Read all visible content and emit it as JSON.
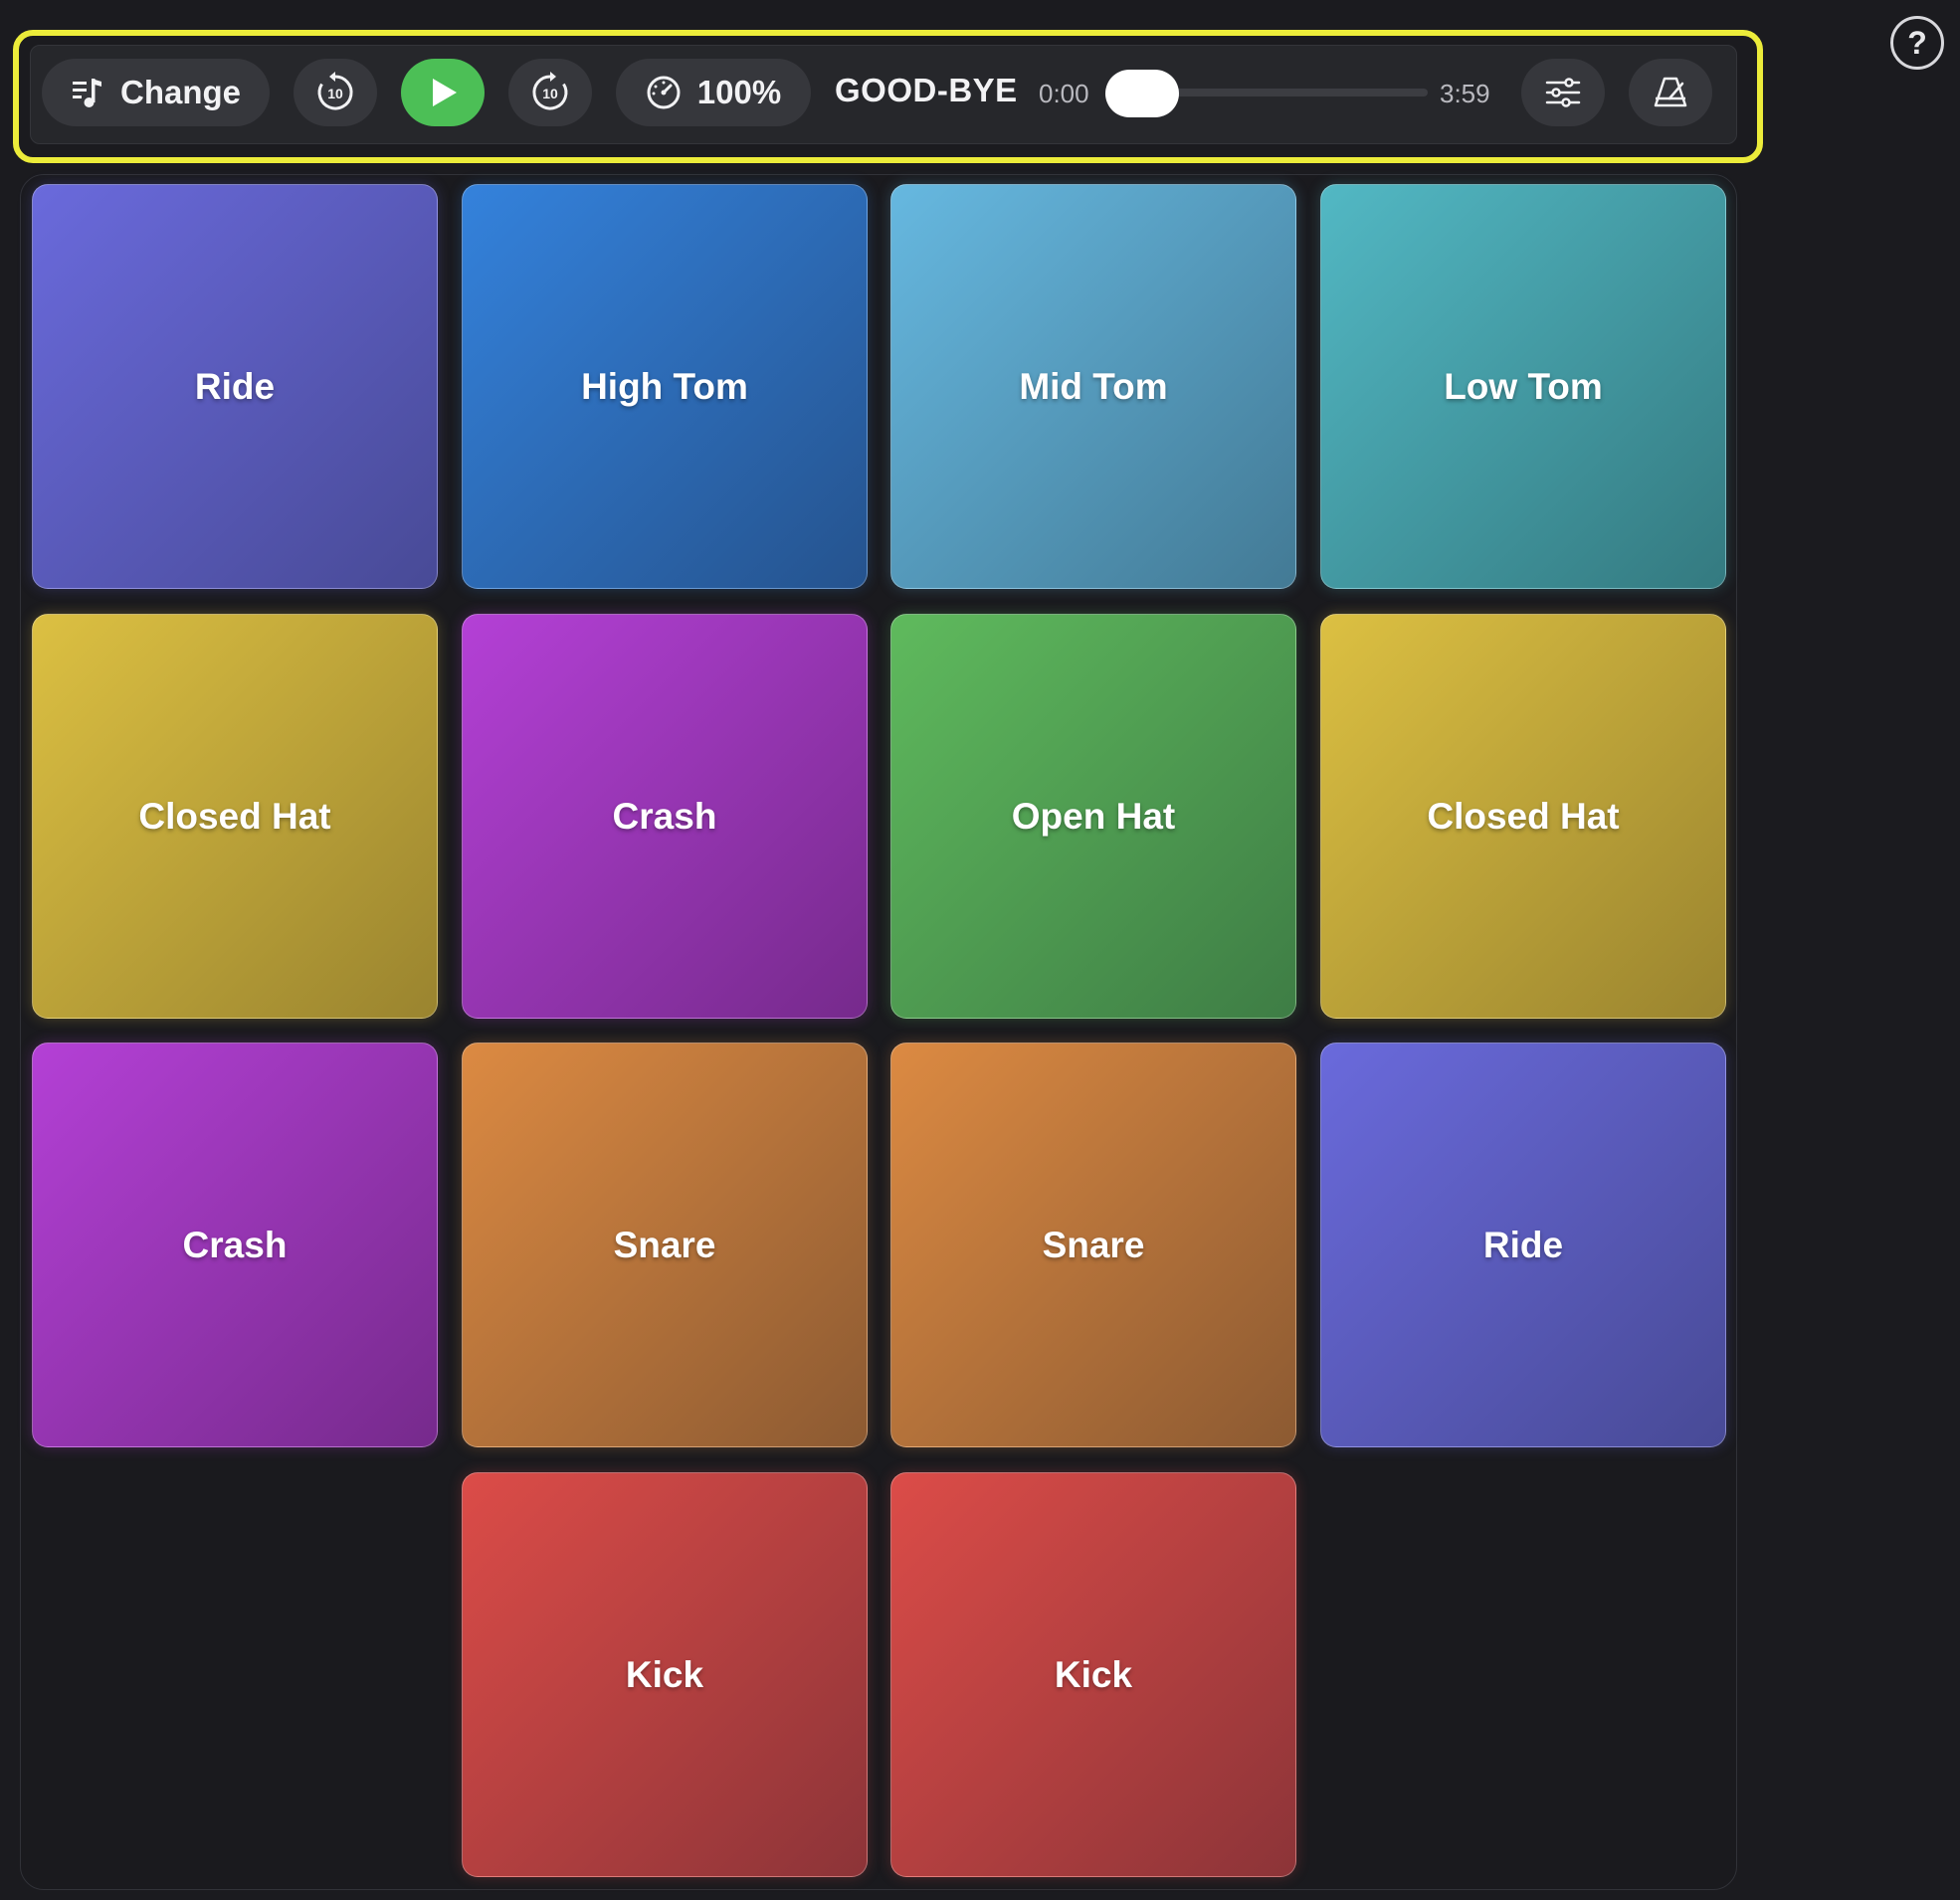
{
  "help": {
    "label": "?"
  },
  "toolbar": {
    "change_label": "Change",
    "rewind_seconds": "10",
    "forward_seconds": "10",
    "speed_label": "100%",
    "song_title": "GOOD-BYE",
    "time_current": "0:00",
    "time_total": "3:59",
    "progress": 0,
    "play_color": "#4cbf56"
  },
  "pads": [
    {
      "label": "Ride",
      "color_from": "#6a6adc",
      "color_to": "#484a96"
    },
    {
      "label": "High Tom",
      "color_from": "#3482dc",
      "color_to": "#25538e"
    },
    {
      "label": "Mid Tom",
      "color_from": "#66b8e0",
      "color_to": "#437a95"
    },
    {
      "label": "Low Tom",
      "color_from": "#52b8c4",
      "color_to": "#347a80"
    },
    {
      "label": "Closed Hat",
      "color_from": "#dcc042",
      "color_to": "#9a842f"
    },
    {
      "label": "Crash",
      "color_from": "#b440d6",
      "color_to": "#762a8c"
    },
    {
      "label": "Open Hat",
      "color_from": "#5fba5d",
      "color_to": "#3e7d45"
    },
    {
      "label": "Closed Hat",
      "color_from": "#dcc042",
      "color_to": "#9a842f"
    },
    {
      "label": "Crash",
      "color_from": "#b440d6",
      "color_to": "#762a8c"
    },
    {
      "label": "Snare",
      "color_from": "#dc8a42",
      "color_to": "#8c5a32"
    },
    {
      "label": "Snare",
      "color_from": "#dc8a42",
      "color_to": "#8c5a32"
    },
    {
      "label": "Ride",
      "color_from": "#6a6adc",
      "color_to": "#484a96"
    },
    {
      "label": "Kick",
      "color_from": "#dc4c48",
      "color_to": "#8c3438"
    },
    {
      "label": "Kick",
      "color_from": "#dc4c48",
      "color_to": "#8c3438"
    }
  ]
}
